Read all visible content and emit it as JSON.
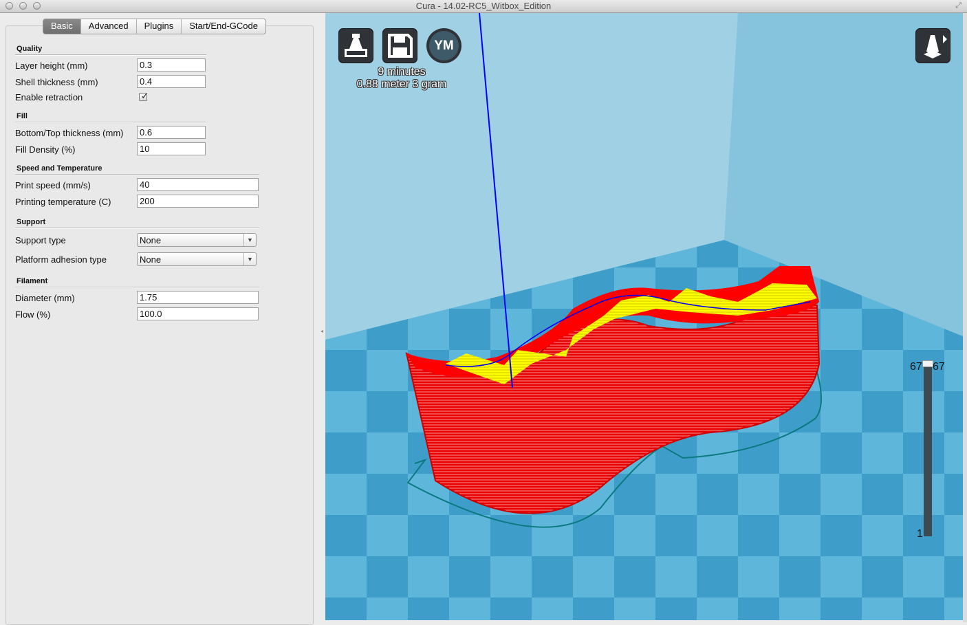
{
  "window": {
    "title": "Cura - 14.02-RC5_Witbox_Edition"
  },
  "tabs": [
    "Basic",
    "Advanced",
    "Plugins",
    "Start/End-GCode"
  ],
  "sections": {
    "quality": "Quality",
    "fill": "Fill",
    "speed": "Speed and Temperature",
    "support": "Support",
    "filament": "Filament"
  },
  "settings": {
    "layer_height": {
      "label": "Layer height (mm)",
      "value": "0.3"
    },
    "shell_thickness": {
      "label": "Shell thickness (mm)",
      "value": "0.4"
    },
    "enable_retraction": {
      "label": "Enable retraction",
      "checked": true
    },
    "bottom_top": {
      "label": "Bottom/Top thickness (mm)",
      "value": "0.6"
    },
    "fill_density": {
      "label": "Fill Density (%)",
      "value": "10"
    },
    "print_speed": {
      "label": "Print speed (mm/s)",
      "value": "40"
    },
    "print_temp": {
      "label": "Printing temperature (C)",
      "value": "200"
    },
    "support_type": {
      "label": "Support type",
      "value": "None"
    },
    "adhesion": {
      "label": "Platform adhesion type",
      "value": "None"
    },
    "diameter": {
      "label": "Diameter (mm)",
      "value": "1.75"
    },
    "flow": {
      "label": "Flow (%)",
      "value": "100.0"
    }
  },
  "viewport": {
    "print_time": "9 minutes",
    "material": "0.88 meter 3 gram",
    "ym_button": "YM",
    "layer_top_left": "67",
    "layer_top_right": "67",
    "layer_bottom": "1",
    "colors": {
      "model_red": "#ff0000",
      "infill_yellow": "#ffff00",
      "travel_blue": "#0000ff",
      "skirt_teal": "#007a80",
      "floor_light": "#5fb8dc",
      "floor_dark": "#3c9cc7"
    }
  },
  "icons": [
    "print-icon",
    "save-icon",
    "view-mode-icon",
    "checkmark-icon",
    "dropdown-arrow-icon"
  ]
}
